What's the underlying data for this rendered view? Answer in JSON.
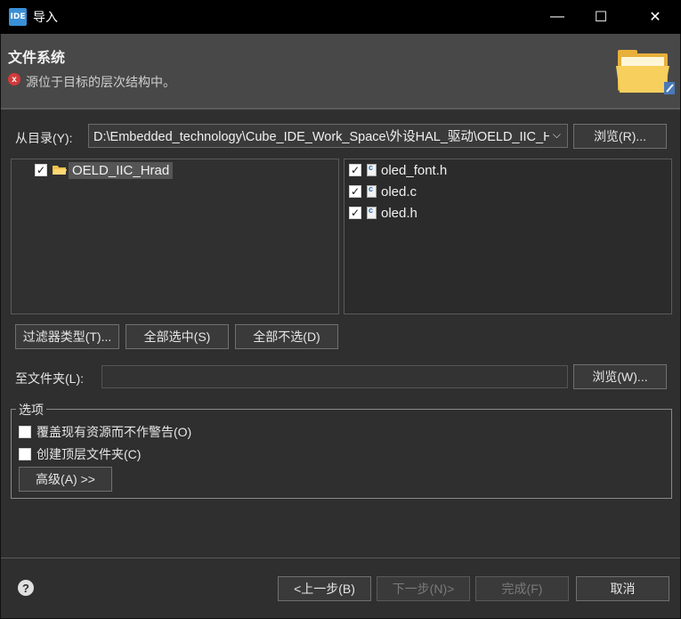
{
  "window": {
    "icon_label": "IDE",
    "title": "导入",
    "minimize": "—",
    "maximize": "☐",
    "close": "✕"
  },
  "header": {
    "title": "文件系统",
    "error_glyph": "x",
    "message": "源位于目标的层次结构中。"
  },
  "source": {
    "label": "从目录(Y):",
    "value": "D:\\Embedded_technology\\Cube_IDE_Work_Space\\外设HAL_驱动\\OELD_IIC_Hrad",
    "arrow": "⌵",
    "browse_label": "浏览(R)..."
  },
  "folder_tree": {
    "items": [
      {
        "label": "OELD_IIC_Hrad",
        "checked": true
      }
    ]
  },
  "file_list": {
    "items": [
      {
        "label": "oled_font.h",
        "checked": true
      },
      {
        "label": "oled.c",
        "checked": true
      },
      {
        "label": "oled.h",
        "checked": true
      }
    ]
  },
  "selection_buttons": {
    "filter_types": "过滤器类型(T)...",
    "select_all": "全部选中(S)",
    "deselect_all": "全部不选(D)"
  },
  "destination": {
    "label": "至文件夹(L):",
    "value": "",
    "browse_label": "浏览(W)..."
  },
  "options": {
    "title": "选项",
    "overwrite": {
      "label": "覆盖现有资源而不作警告(O)",
      "checked": false
    },
    "create_top_folder": {
      "label": "创建顶层文件夹(C)",
      "checked": false
    },
    "advanced_label": "高级(A) >>"
  },
  "footer": {
    "help_glyph": "?",
    "back_label": "<上一步(B)",
    "next_label": "下一步(N)>",
    "finish_label": "完成(F)",
    "cancel_label": "取消"
  },
  "colors": {
    "background": "#2f2f2f",
    "header_background": "#484848",
    "error": "#d23a3a",
    "folder": "#f3c24a"
  }
}
